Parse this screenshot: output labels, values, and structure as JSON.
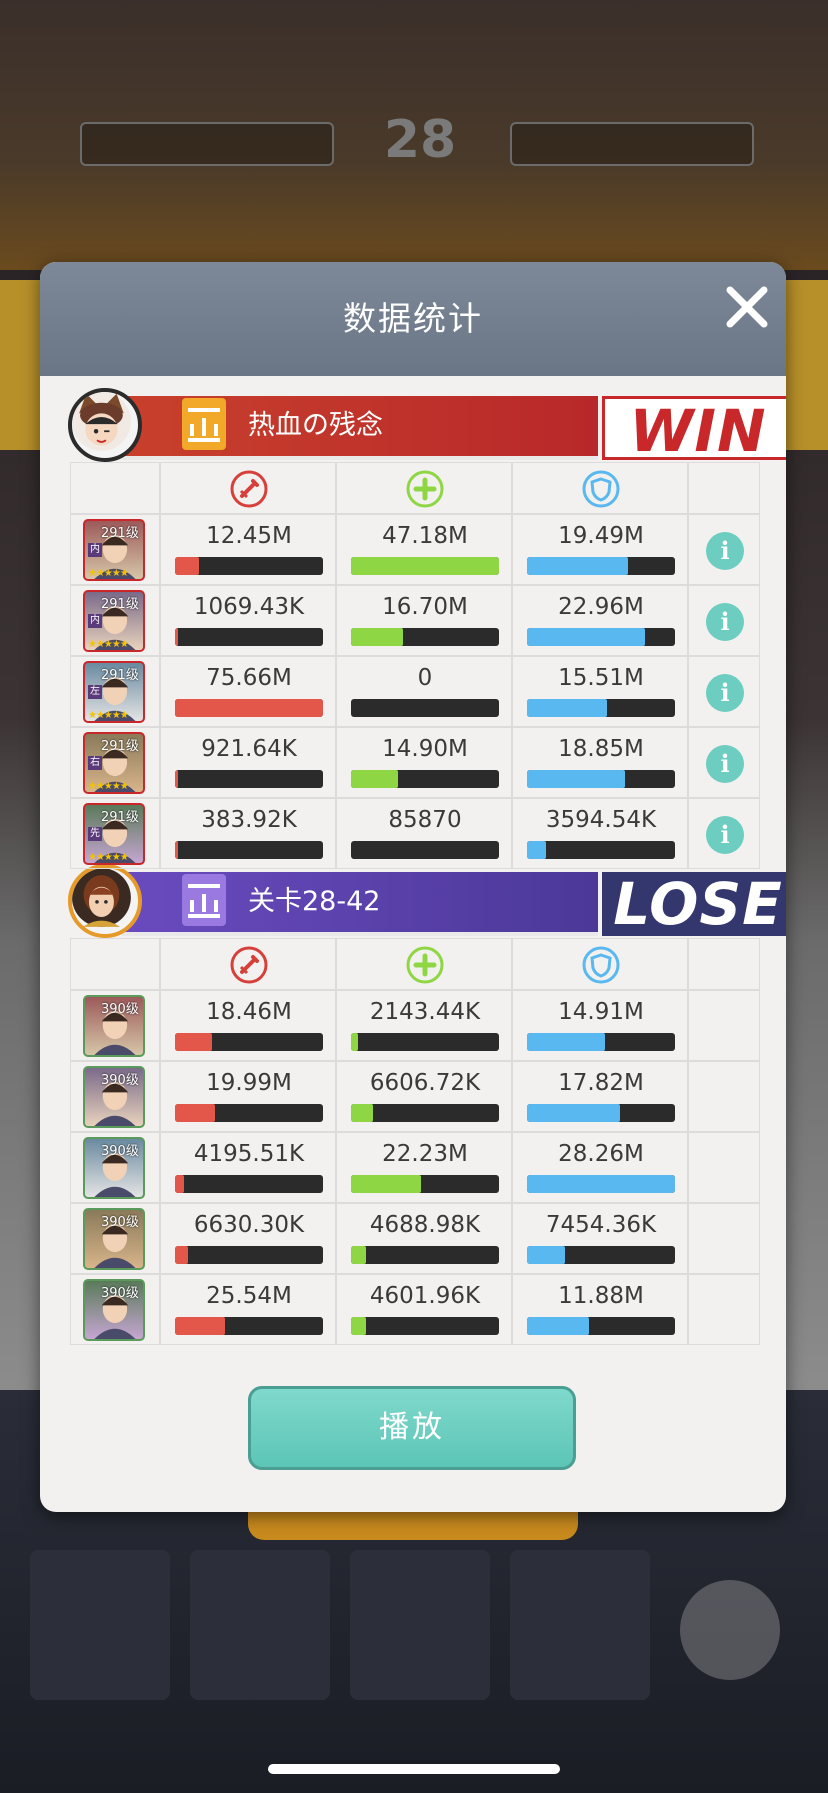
{
  "background": {
    "round_number": "28"
  },
  "dialog": {
    "title": "数据统计",
    "close_icon": "close-icon",
    "play_label": "播放"
  },
  "colors": {
    "damage": "#e2574a",
    "heal": "#8fd644",
    "defense": "#5ab8f0",
    "win": "#c8282a",
    "lose_bg": "#34366e",
    "teal": "#6ccdc0"
  },
  "stat_icons": [
    "sword-icon",
    "plus-icon",
    "shield-icon"
  ],
  "team1": {
    "name": "热血の残念",
    "result": "WIN",
    "heroes": [
      {
        "level": "291级",
        "position": "内",
        "damage": "12.45M",
        "damage_ratio": 0.16,
        "heal": "47.18M",
        "heal_ratio": 1.0,
        "defense": "19.49M",
        "defense_ratio": 0.68
      },
      {
        "level": "291级",
        "position": "内",
        "damage": "1069.43K",
        "damage_ratio": 0.02,
        "heal": "16.70M",
        "heal_ratio": 0.35,
        "defense": "22.96M",
        "defense_ratio": 0.8
      },
      {
        "level": "291级",
        "position": "左",
        "damage": "75.66M",
        "damage_ratio": 1.0,
        "heal": "0",
        "heal_ratio": 0.0,
        "defense": "15.51M",
        "defense_ratio": 0.54
      },
      {
        "level": "291级",
        "position": "右",
        "damage": "921.64K",
        "damage_ratio": 0.02,
        "heal": "14.90M",
        "heal_ratio": 0.32,
        "defense": "18.85M",
        "defense_ratio": 0.66
      },
      {
        "level": "291级",
        "position": "先",
        "damage": "383.92K",
        "damage_ratio": 0.01,
        "heal": "85870",
        "heal_ratio": 0.0,
        "defense": "3594.54K",
        "defense_ratio": 0.13
      }
    ]
  },
  "team2": {
    "name": "关卡28-42",
    "result": "LOSE",
    "heroes": [
      {
        "level": "390级",
        "damage": "18.46M",
        "damage_ratio": 0.25,
        "heal": "2143.44K",
        "heal_ratio": 0.05,
        "defense": "14.91M",
        "defense_ratio": 0.53
      },
      {
        "level": "390级",
        "damage": "19.99M",
        "damage_ratio": 0.27,
        "heal": "6606.72K",
        "heal_ratio": 0.15,
        "defense": "17.82M",
        "defense_ratio": 0.63
      },
      {
        "level": "390级",
        "damage": "4195.51K",
        "damage_ratio": 0.06,
        "heal": "22.23M",
        "heal_ratio": 0.47,
        "defense": "28.26M",
        "defense_ratio": 1.0
      },
      {
        "level": "390级",
        "damage": "6630.30K",
        "damage_ratio": 0.09,
        "heal": "4688.98K",
        "heal_ratio": 0.1,
        "defense": "7454.36K",
        "defense_ratio": 0.26
      },
      {
        "level": "390级",
        "damage": "25.54M",
        "damage_ratio": 0.34,
        "heal": "4601.96K",
        "heal_ratio": 0.1,
        "defense": "11.88M",
        "defense_ratio": 0.42
      }
    ]
  }
}
